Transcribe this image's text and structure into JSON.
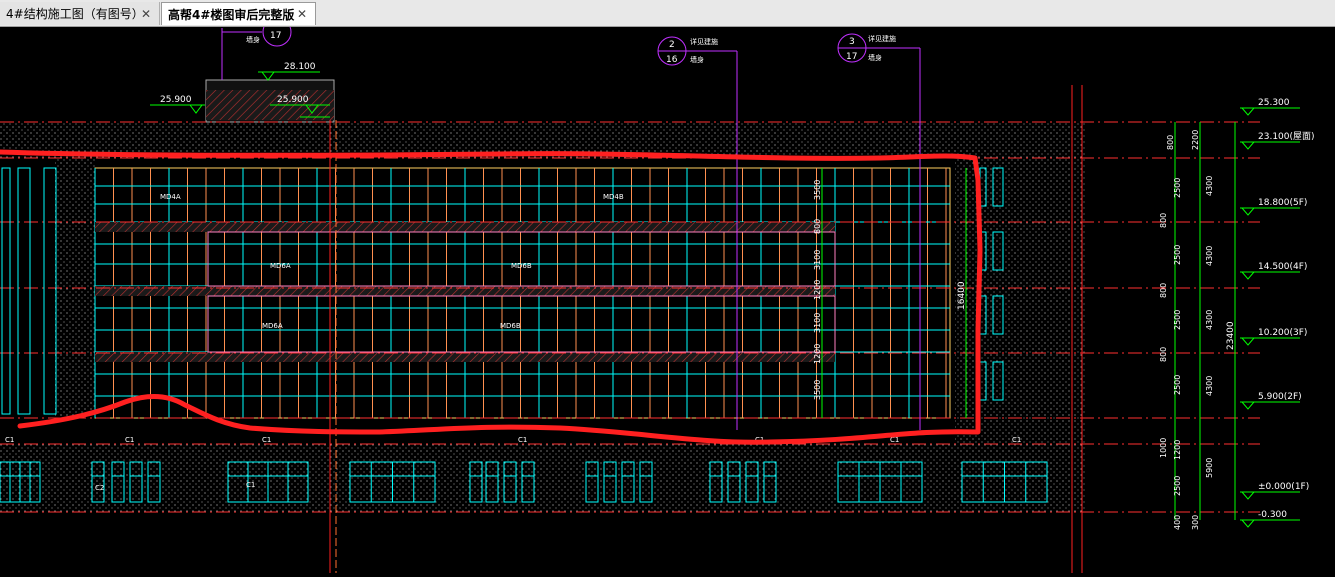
{
  "tabs": [
    {
      "label": "4#结构施工图（有图号）",
      "close": "✕"
    },
    {
      "label": "高帮4#楼图审后完整版",
      "close": "✕"
    }
  ],
  "elevations": [
    {
      "label": "25.300"
    },
    {
      "label": "23.100(屋面)"
    },
    {
      "label": "18.800(5F)"
    },
    {
      "label": "14.500(4F)"
    },
    {
      "label": "10.200(3F)"
    },
    {
      "label": "5.900(2F)"
    },
    {
      "label": "±0.000(1F)"
    },
    {
      "label": "-0.300"
    }
  ],
  "top_marks": {
    "a": "28.100",
    "b": "25.900",
    "c": "25.900"
  },
  "callouts": [
    {
      "num": "",
      "sheet": "17",
      "note": "墙身"
    },
    {
      "num": "2",
      "sheet": "16",
      "note": "详见建施",
      "note2": "墙身"
    },
    {
      "num": "3",
      "sheet": "17",
      "note": "详见建施",
      "note2": "墙身"
    }
  ],
  "dims_right": [
    "2200",
    "800",
    "2500",
    "800",
    "2500",
    "800",
    "2500",
    "800",
    "2500",
    "1000",
    "1200",
    "2500",
    "400",
    "300"
  ],
  "dims_right2": [
    "4300",
    "4300",
    "4300",
    "4300",
    "5900"
  ],
  "dim_total": "23400",
  "dim_mid": "16400",
  "vdims_inner": [
    "3500",
    "800",
    "3100",
    "1200",
    "3100",
    "1200",
    "3500"
  ],
  "window_labels": [
    "MD4A",
    "MD4B",
    "MD6A",
    "MD6B",
    "MD6A",
    "MD6B"
  ],
  "c_labels": [
    "C1",
    "C1",
    "C1",
    "C1",
    "C1",
    "C1",
    "C1",
    "C1",
    "C2"
  ],
  "accent": {
    "red": "#ff2020",
    "cyan": "#00ffff",
    "magenta": "#c030ff",
    "green": "#00ff00",
    "orange": "#ffa040"
  }
}
